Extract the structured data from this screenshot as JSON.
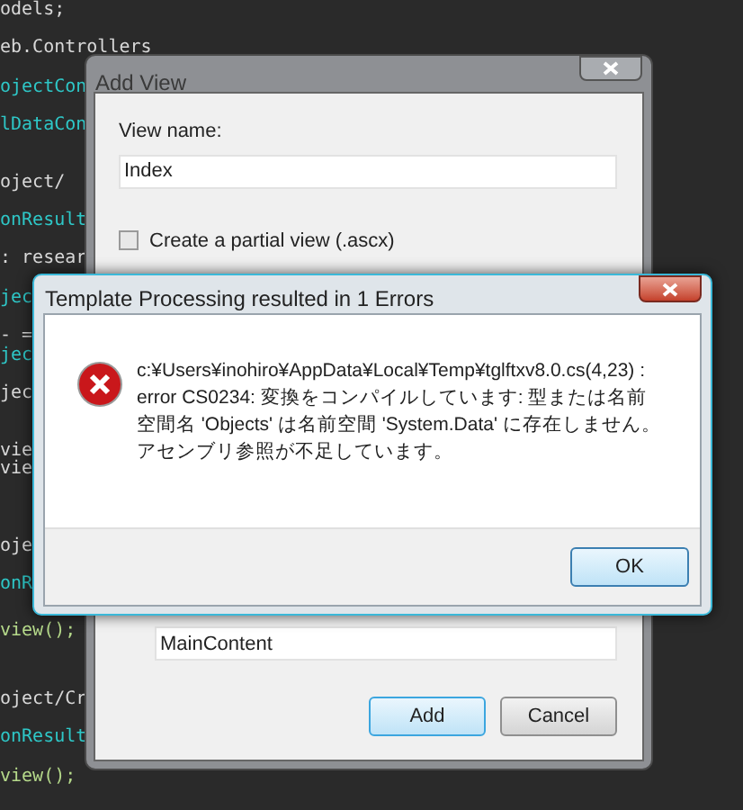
{
  "editor": {
    "lines": [
      {
        "text": "odels;",
        "kind": "plain"
      },
      {
        "text": "eb.Controllers",
        "kind": "plain"
      },
      {
        "text": "ojectCon",
        "kind": "type"
      },
      {
        "text": "lDataCon",
        "kind": "type"
      },
      {
        "text": "oject/",
        "kind": "plain"
      },
      {
        "text": "onResult",
        "kind": "type"
      },
      {
        "text": ": resear",
        "kind": "plain"
      },
      {
        "text": "jec",
        "kind": "type"
      },
      {
        "text": "- =",
        "kind": "plain"
      },
      {
        "text": "jec",
        "kind": "type"
      },
      {
        "text": "jec",
        "kind": "plain"
      },
      {
        "text": "vie",
        "kind": "plain"
      },
      {
        "text": "vie",
        "kind": "plain"
      },
      {
        "text": "oje",
        "kind": "plain"
      },
      {
        "text": "onR",
        "kind": "type"
      },
      {
        "text": "view();",
        "kind": "call"
      },
      {
        "text": "oject/Cr",
        "kind": "plain"
      },
      {
        "text": "onResult",
        "kind": "type"
      },
      {
        "text": "view();",
        "kind": "call"
      }
    ]
  },
  "add_view": {
    "title": "Add View",
    "view_name_label": "View name:",
    "view_name_value": "Index",
    "partial_view": {
      "label": "Create a partial view (.ascx)",
      "checked": false
    },
    "content_value": "MainContent",
    "buttons": [
      {
        "label": "Add",
        "default": true
      },
      {
        "label": "Cancel",
        "default": false
      }
    ]
  },
  "error_dialog": {
    "title": "Template Processing resulted in 1 Errors",
    "message": "c:¥Users¥inohiro¥AppData¥Local¥Temp¥tglftxv8.0.cs(4,23) : error CS0234: 変換をコンパイルしています: 型または名前空間名 'Objects' は名前空間 'System.Data' に存在しません。アセンブリ参照が不足しています。",
    "button": "OK"
  }
}
